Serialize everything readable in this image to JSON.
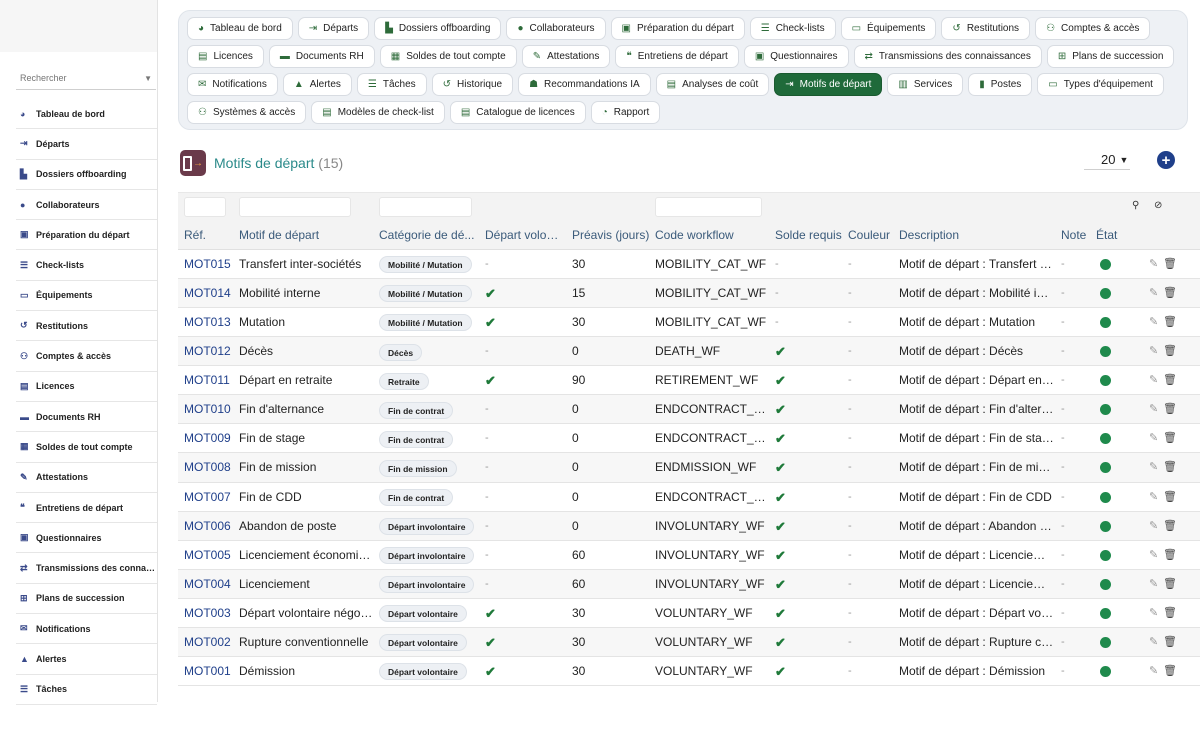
{
  "sidebar": {
    "search_placeholder": "Rechercher",
    "items": [
      {
        "label": "Tableau de bord",
        "icon": "dashboard-icon",
        "glyph": "◕"
      },
      {
        "label": "Départs",
        "icon": "exit-icon",
        "glyph": "⇥"
      },
      {
        "label": "Dossiers offboarding",
        "icon": "folder-user-icon",
        "glyph": "▙"
      },
      {
        "label": "Collaborateurs",
        "icon": "user-icon",
        "glyph": "●"
      },
      {
        "label": "Préparation du départ",
        "icon": "clipboard-icon",
        "glyph": "▣"
      },
      {
        "label": "Check-lists",
        "icon": "checklist-icon",
        "glyph": "☰"
      },
      {
        "label": "Équipements",
        "icon": "laptop-icon",
        "glyph": "▭"
      },
      {
        "label": "Restitutions",
        "icon": "return-icon",
        "glyph": "↺"
      },
      {
        "label": "Comptes & accès",
        "icon": "users-icon",
        "glyph": "⚇"
      },
      {
        "label": "Licences",
        "icon": "license-icon",
        "glyph": "▤"
      },
      {
        "label": "Documents RH",
        "icon": "folder-icon",
        "glyph": "▬"
      },
      {
        "label": "Soldes de tout compte",
        "icon": "money-icon",
        "glyph": "▦"
      },
      {
        "label": "Attestations",
        "icon": "certificate-icon",
        "glyph": "✎"
      },
      {
        "label": "Entretiens de départ",
        "icon": "comments-icon",
        "glyph": "❝"
      },
      {
        "label": "Questionnaires",
        "icon": "survey-icon",
        "glyph": "▣"
      },
      {
        "label": "Transmissions des connaissances",
        "icon": "transfer-icon",
        "glyph": "⇄"
      },
      {
        "label": "Plans de succession",
        "icon": "sitemap-icon",
        "glyph": "⊞"
      },
      {
        "label": "Notifications",
        "icon": "envelope-icon",
        "glyph": "✉"
      },
      {
        "label": "Alertes",
        "icon": "bell-icon",
        "glyph": "▲"
      },
      {
        "label": "Tâches",
        "icon": "tasks-icon",
        "glyph": "☰"
      }
    ]
  },
  "topnav": {
    "chips": [
      {
        "label": "Tableau de bord",
        "icon": "dashboard-icon",
        "glyph": "◕",
        "active": false
      },
      {
        "label": "Départs",
        "icon": "exit-icon",
        "glyph": "⇥",
        "active": false
      },
      {
        "label": "Dossiers offboarding",
        "icon": "folder-user-icon",
        "glyph": "▙",
        "active": false
      },
      {
        "label": "Collaborateurs",
        "icon": "user-icon",
        "glyph": "●",
        "active": false
      },
      {
        "label": "Préparation du départ",
        "icon": "clipboard-icon",
        "glyph": "▣",
        "active": false
      },
      {
        "label": "Check-lists",
        "icon": "checklist-icon",
        "glyph": "☰",
        "active": false
      },
      {
        "label": "Équipements",
        "icon": "laptop-icon",
        "glyph": "▭",
        "active": false
      },
      {
        "label": "Restitutions",
        "icon": "return-icon",
        "glyph": "↺",
        "active": false
      },
      {
        "label": "Comptes & accès",
        "icon": "users-icon",
        "glyph": "⚇",
        "active": false
      },
      {
        "label": "Licences",
        "icon": "license-icon",
        "glyph": "▤",
        "active": false
      },
      {
        "label": "Documents RH",
        "icon": "folder-icon",
        "glyph": "▬",
        "active": false
      },
      {
        "label": "Soldes de tout compte",
        "icon": "money-icon",
        "glyph": "▦",
        "active": false
      },
      {
        "label": "Attestations",
        "icon": "certificate-icon",
        "glyph": "✎",
        "active": false
      },
      {
        "label": "Entretiens de départ",
        "icon": "comments-icon",
        "glyph": "❝",
        "active": false
      },
      {
        "label": "Questionnaires",
        "icon": "survey-icon",
        "glyph": "▣",
        "active": false
      },
      {
        "label": "Transmissions des connaissances",
        "icon": "transfer-icon",
        "glyph": "⇄",
        "active": false
      },
      {
        "label": "Plans de succession",
        "icon": "sitemap-icon",
        "glyph": "⊞",
        "active": false
      },
      {
        "label": "Notifications",
        "icon": "envelope-icon",
        "glyph": "✉",
        "active": false
      },
      {
        "label": "Alertes",
        "icon": "bell-icon",
        "glyph": "▲",
        "active": false
      },
      {
        "label": "Tâches",
        "icon": "tasks-icon",
        "glyph": "☰",
        "active": false
      },
      {
        "label": "Historique",
        "icon": "history-icon",
        "glyph": "↺",
        "active": false
      },
      {
        "label": "Recommandations IA",
        "icon": "robot-icon",
        "glyph": "☗",
        "active": false
      },
      {
        "label": "Analyses de coût",
        "icon": "cost-icon",
        "glyph": "▤",
        "active": false
      },
      {
        "label": "Motifs de départ",
        "icon": "exit-icon",
        "glyph": "⇥",
        "active": true
      },
      {
        "label": "Services",
        "icon": "building-icon",
        "glyph": "▥",
        "active": false
      },
      {
        "label": "Postes",
        "icon": "badge-icon",
        "glyph": "▮",
        "active": false
      },
      {
        "label": "Types d'équipement",
        "icon": "laptop-icon",
        "glyph": "▭",
        "active": false
      },
      {
        "label": "Systèmes & accès",
        "icon": "network-icon",
        "glyph": "⚇",
        "active": false
      },
      {
        "label": "Modèles de check-list",
        "icon": "template-icon",
        "glyph": "▤",
        "active": false
      },
      {
        "label": "Catalogue de licences",
        "icon": "catalog-icon",
        "glyph": "▤",
        "active": false
      },
      {
        "label": "Rapport",
        "icon": "chart-pie-icon",
        "glyph": "◔",
        "active": false
      }
    ]
  },
  "page": {
    "title": "Motifs de départ",
    "count": "(15)",
    "page_size": "20",
    "add_label": "+",
    "accent_color": "#2a8a8a"
  },
  "table": {
    "columns": [
      "Réf.",
      "Motif de départ",
      "Catégorie de dé...",
      "Départ volon...",
      "Préavis (jours)",
      "Code workflow",
      "Solde requis",
      "Couleur",
      "Description",
      "Note",
      "État"
    ],
    "rows": [
      {
        "ref": "MOT015",
        "motif": "Transfert inter-sociétés",
        "categorie": "Mobilité / Mutation",
        "volontaire": false,
        "preavis": "30",
        "workflow": "MOBILITY_CAT_WF",
        "solde": false,
        "couleur": "-",
        "description": "Motif de départ : Transfert inter-sociétés",
        "note": "-"
      },
      {
        "ref": "MOT014",
        "motif": "Mobilité interne",
        "categorie": "Mobilité / Mutation",
        "volontaire": true,
        "preavis": "15",
        "workflow": "MOBILITY_CAT_WF",
        "solde": false,
        "couleur": "-",
        "description": "Motif de départ : Mobilité interne",
        "note": "-"
      },
      {
        "ref": "MOT013",
        "motif": "Mutation",
        "categorie": "Mobilité / Mutation",
        "volontaire": true,
        "preavis": "30",
        "workflow": "MOBILITY_CAT_WF",
        "solde": false,
        "couleur": "-",
        "description": "Motif de départ : Mutation",
        "note": "-"
      },
      {
        "ref": "MOT012",
        "motif": "Décès",
        "categorie": "Décès",
        "volontaire": false,
        "preavis": "0",
        "workflow": "DEATH_WF",
        "solde": true,
        "couleur": "-",
        "description": "Motif de départ : Décès",
        "note": "-"
      },
      {
        "ref": "MOT011",
        "motif": "Départ en retraite",
        "categorie": "Retraite",
        "volontaire": true,
        "preavis": "90",
        "workflow": "RETIREMENT_WF",
        "solde": true,
        "couleur": "-",
        "description": "Motif de départ : Départ en retraite",
        "note": "-"
      },
      {
        "ref": "MOT010",
        "motif": "Fin d'alternance",
        "categorie": "Fin de contrat",
        "volontaire": false,
        "preavis": "0",
        "workflow": "ENDCONTRACT_WF",
        "solde": true,
        "couleur": "-",
        "description": "Motif de départ : Fin d'alternance",
        "note": "-"
      },
      {
        "ref": "MOT009",
        "motif": "Fin de stage",
        "categorie": "Fin de contrat",
        "volontaire": false,
        "preavis": "0",
        "workflow": "ENDCONTRACT_WF",
        "solde": true,
        "couleur": "-",
        "description": "Motif de départ : Fin de stage",
        "note": "-"
      },
      {
        "ref": "MOT008",
        "motif": "Fin de mission",
        "categorie": "Fin de mission",
        "volontaire": false,
        "preavis": "0",
        "workflow": "ENDMISSION_WF",
        "solde": true,
        "couleur": "-",
        "description": "Motif de départ : Fin de mission",
        "note": "-"
      },
      {
        "ref": "MOT007",
        "motif": "Fin de CDD",
        "categorie": "Fin de contrat",
        "volontaire": false,
        "preavis": "0",
        "workflow": "ENDCONTRACT_WF",
        "solde": true,
        "couleur": "-",
        "description": "Motif de départ : Fin de CDD",
        "note": "-"
      },
      {
        "ref": "MOT006",
        "motif": "Abandon de poste",
        "categorie": "Départ involontaire",
        "volontaire": false,
        "preavis": "0",
        "workflow": "INVOLUNTARY_WF",
        "solde": true,
        "couleur": "-",
        "description": "Motif de départ : Abandon de poste",
        "note": "-"
      },
      {
        "ref": "MOT005",
        "motif": "Licenciement économique",
        "categorie": "Départ involontaire",
        "volontaire": false,
        "preavis": "60",
        "workflow": "INVOLUNTARY_WF",
        "solde": true,
        "couleur": "-",
        "description": "Motif de départ : Licenciement économique",
        "note": "-"
      },
      {
        "ref": "MOT004",
        "motif": "Licenciement",
        "categorie": "Départ involontaire",
        "volontaire": false,
        "preavis": "60",
        "workflow": "INVOLUNTARY_WF",
        "solde": true,
        "couleur": "-",
        "description": "Motif de départ : Licenciement",
        "note": "-"
      },
      {
        "ref": "MOT003",
        "motif": "Départ volontaire négocié",
        "categorie": "Départ volontaire",
        "volontaire": true,
        "preavis": "30",
        "workflow": "VOLUNTARY_WF",
        "solde": true,
        "couleur": "-",
        "description": "Motif de départ : Départ volontaire négocié",
        "note": "-"
      },
      {
        "ref": "MOT002",
        "motif": "Rupture conventionnelle",
        "categorie": "Départ volontaire",
        "volontaire": true,
        "preavis": "30",
        "workflow": "VOLUNTARY_WF",
        "solde": true,
        "couleur": "-",
        "description": "Motif de départ : Rupture conventionnelle",
        "note": "-"
      },
      {
        "ref": "MOT001",
        "motif": "Démission",
        "categorie": "Départ volontaire",
        "volontaire": true,
        "preavis": "30",
        "workflow": "VOLUNTARY_WF",
        "solde": true,
        "couleur": "-",
        "description": "Motif de départ : Démission",
        "note": "-"
      }
    ],
    "status_color": "#1f8a4c",
    "check_glyph": "✔",
    "dash_glyph": "-",
    "edit_glyph": "✎",
    "delete_glyph": "🗑"
  }
}
